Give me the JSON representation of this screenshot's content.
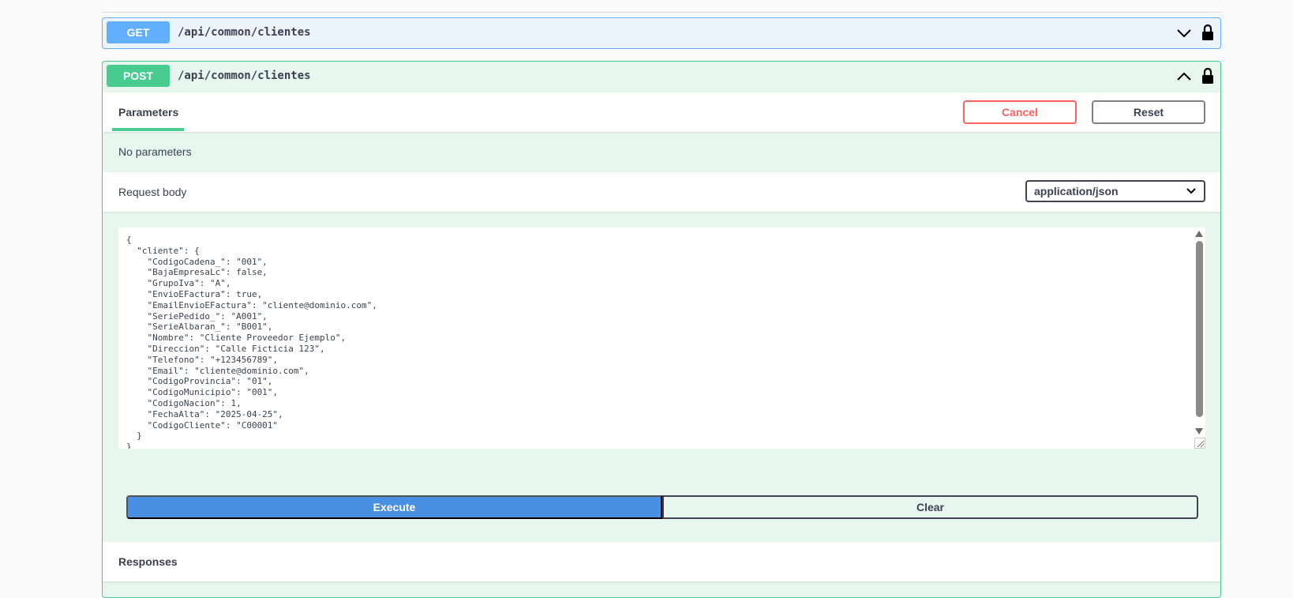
{
  "operations": [
    {
      "method": "GET",
      "path": "/api/common/clientes",
      "expanded": false,
      "color": "#61affe"
    },
    {
      "method": "POST",
      "path": "/api/common/clientes",
      "expanded": true,
      "color": "#49cc90",
      "parameters_tab": "Parameters",
      "cancel_label": "Cancel",
      "reset_label": "Reset",
      "no_parameters": "No parameters",
      "request_body_label": "Request body",
      "content_type": "application/json",
      "request_body": "{\n  \"cliente\": {\n    \"CodigoCadena_\": \"001\",\n    \"BajaEmpresaLc\": false,\n    \"GrupoIva\": \"A\",\n    \"EnvioEFactura\": true,\n    \"EmailEnvioEFactura\": \"cliente@dominio.com\",\n    \"SeriePedido_\": \"A001\",\n    \"SerieAlbaran_\": \"B001\",\n    \"Nombre\": \"Cliente Proveedor Ejemplo\",\n    \"Direccion\": \"Calle Ficticia 123\",\n    \"Telefono\": \"+123456789\",\n    \"Email\": \"cliente@dominio.com\",\n    \"CodigoProvincia\": \"01\",\n    \"CodigoMunicipio\": \"001\",\n    \"CodigoNacion\": 1,\n    \"FechaAlta\": \"2025-04-25\",\n    \"CodigoCliente\": \"C00001\"\n  }\n}",
      "execute_label": "Execute",
      "clear_label": "Clear",
      "responses_label": "Responses"
    }
  ],
  "colors": {
    "execute": "#4990e2",
    "cancel": "#ff6060"
  }
}
